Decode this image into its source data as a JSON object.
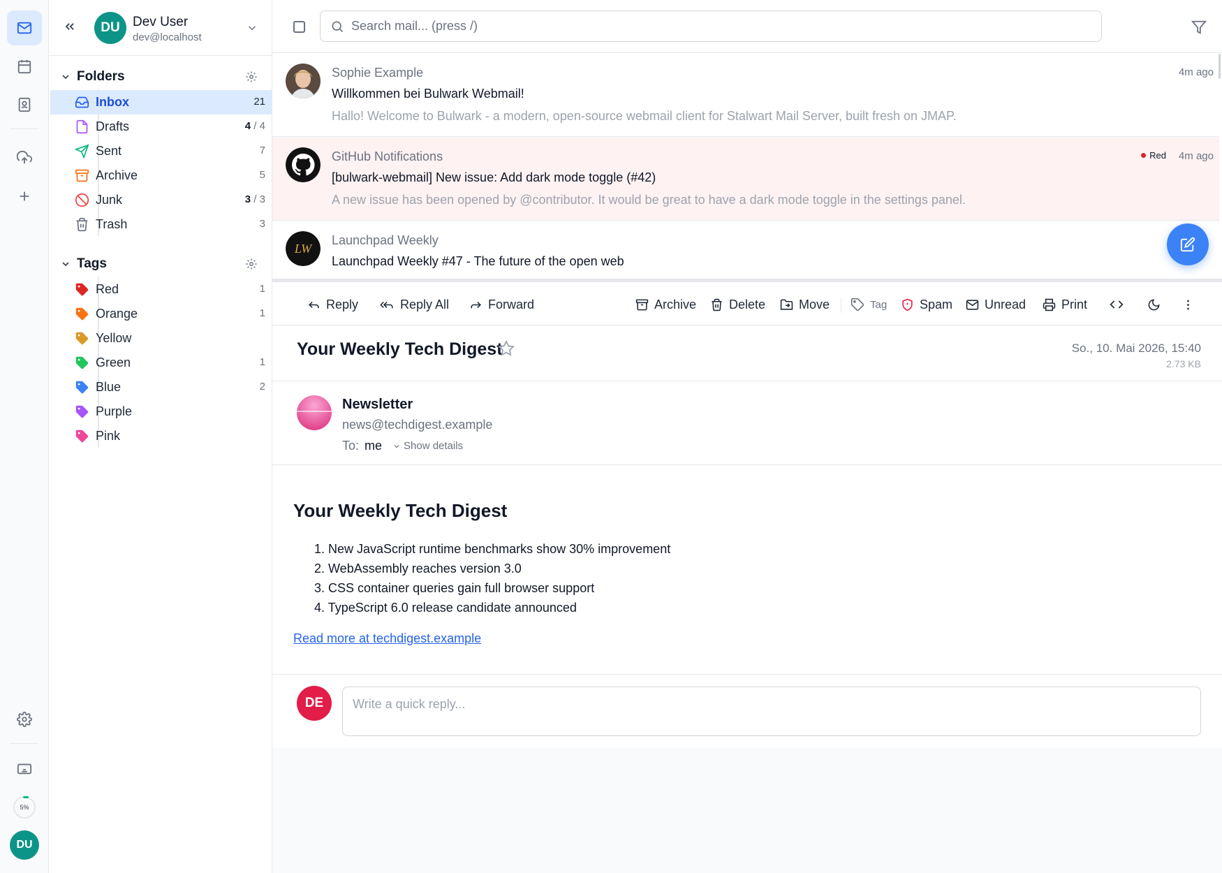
{
  "rail": {
    "quota": "5%",
    "avatar": "DU",
    "icons": [
      "mail-icon",
      "calendar-icon",
      "contacts-icon",
      "upload-cloud-icon",
      "plus-icon",
      "gear-icon",
      "keyboard-icon"
    ]
  },
  "account": {
    "initials": "DU",
    "name": "Dev User",
    "email": "dev@localhost"
  },
  "folders": {
    "title": "Folders",
    "items": [
      {
        "label": "Inbox",
        "count": "21",
        "icon": "inbox-icon",
        "color": "#2563eb"
      },
      {
        "label": "Drafts",
        "unread": "4",
        "total": "4",
        "icon": "file-icon",
        "color": "#a855f7"
      },
      {
        "label": "Sent",
        "count": "7",
        "icon": "send-icon",
        "color": "#10b981"
      },
      {
        "label": "Archive",
        "count": "5",
        "icon": "archive-icon",
        "color": "#f97316"
      },
      {
        "label": "Junk",
        "unread": "3",
        "total": "3",
        "icon": "ban-icon",
        "color": "#ef4444"
      },
      {
        "label": "Trash",
        "count": "3",
        "icon": "trash-icon",
        "color": "#6b7280"
      }
    ]
  },
  "tags": {
    "title": "Tags",
    "items": [
      {
        "label": "Red",
        "count": "1",
        "color": "#dc2626"
      },
      {
        "label": "Orange",
        "count": "1",
        "color": "#f97316"
      },
      {
        "label": "Yellow",
        "count": "",
        "color": "#d99a2b"
      },
      {
        "label": "Green",
        "count": "1",
        "color": "#22c55e"
      },
      {
        "label": "Blue",
        "count": "2",
        "color": "#3b82f6"
      },
      {
        "label": "Purple",
        "count": "",
        "color": "#a855f7"
      },
      {
        "label": "Pink",
        "count": "",
        "color": "#ec4899"
      }
    ]
  },
  "search": {
    "placeholder": "Search mail... (press /)"
  },
  "messages": [
    {
      "from": "Sophie Example",
      "subject": "Willkommen bei Bulwark Webmail!",
      "preview": "Hallo! Welcome to Bulwark - a modern, open-source webmail client for Stalwart Mail Server, built fresh on JMAP.",
      "time": "4m ago",
      "tag": ""
    },
    {
      "from": "GitHub Notifications",
      "subject": "[bulwark-webmail] New issue: Add dark mode toggle (#42)",
      "preview": "A new issue has been opened by @contributor. It would be great to have a dark mode toggle in the settings panel.",
      "time": "4m ago",
      "tag": "Red"
    },
    {
      "from": "Launchpad Weekly",
      "subject": "Launchpad Weekly #47 - The future of the open web",
      "preview": "",
      "time": "",
      "tag": ""
    }
  ],
  "toolbar": {
    "reply": "Reply",
    "reply_all": "Reply All",
    "forward": "Forward",
    "archive": "Archive",
    "delete": "Delete",
    "move": "Move",
    "tag": "Tag",
    "spam": "Spam",
    "unread": "Unread",
    "print": "Print"
  },
  "email": {
    "subject": "Your Weekly Tech Digest",
    "date": "So., 10. Mai 2026, 15:40",
    "size": "2.73 KB",
    "sender_name": "Newsletter",
    "sender_email": "news@techdigest.example",
    "to_label": "To:",
    "to": "me",
    "show_details": "Show details",
    "body_heading": "Your Weekly Tech Digest",
    "body_items": [
      "1. New JavaScript runtime benchmarks show 30% improvement",
      "2. WebAssembly reaches version 3.0",
      "3. CSS container queries gain full browser support",
      "4. TypeScript 6.0 release candidate announced"
    ],
    "link": "Read more at techdigest.example"
  },
  "quick_reply": {
    "initials": "DE",
    "placeholder": "Write a quick reply..."
  }
}
